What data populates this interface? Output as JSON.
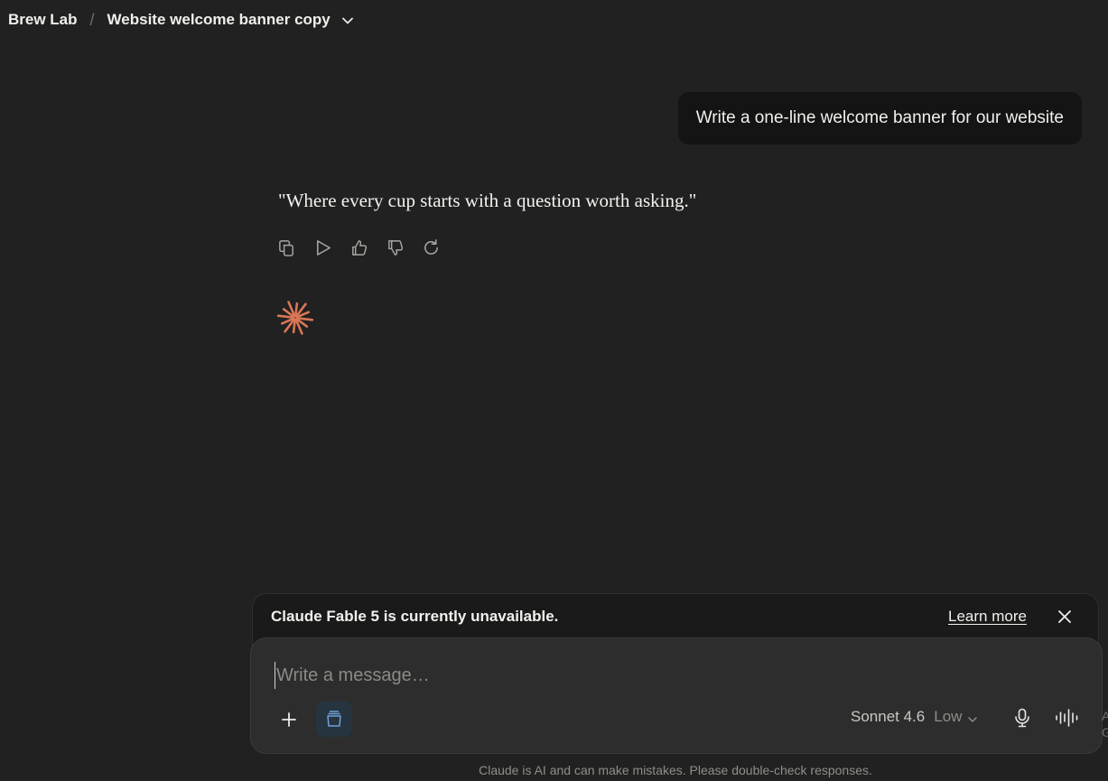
{
  "breadcrumb": {
    "project": "Brew Lab",
    "separator": "/",
    "conversation_title": "Website welcome banner copy"
  },
  "messages": {
    "user": "Write a one-line welcome banner for our website",
    "assistant": "\"Where every cup starts with a question worth asking.\""
  },
  "message_actions": [
    "copy-icon",
    "play-icon",
    "thumbs-up-icon",
    "thumbs-down-icon",
    "retry-icon"
  ],
  "notice": {
    "text": "Claude Fable 5 is currently unavailable.",
    "link": "Learn more"
  },
  "composer": {
    "placeholder": "Write a message…",
    "model": "Sonnet 4.6",
    "effort": "Low"
  },
  "side_clipped": {
    "line1": "A",
    "line2": "G"
  },
  "disclaimer": "Claude is AI and can make mistakes. Please double-check responses.",
  "colors": {
    "background": "#212121",
    "accent_spark": "#d97757",
    "user_bubble": "#141414",
    "composer": "#2d2d2d",
    "project_button": "#26343f"
  }
}
